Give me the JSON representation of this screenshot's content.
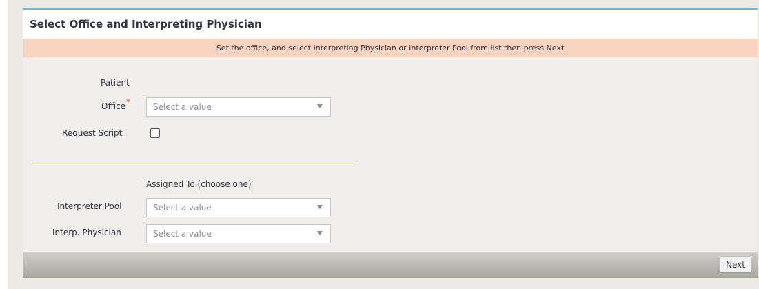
{
  "header": {
    "title": "Select Office and Interpreting Physician"
  },
  "banner": {
    "text": "Set the office, and select Interpreting Physician or Interpreter Pool from list then press Next"
  },
  "form": {
    "patient_label": "Patient",
    "office_label": "Office",
    "office_required_marker": "*",
    "office_select": "Select a value",
    "request_script_label": "Request Script",
    "request_script_checked": false,
    "assigned_to_label": "Assigned To (choose one)",
    "interpreter_pool_label": "Interpreter Pool",
    "interpreter_pool_select": "Select a value",
    "interp_physician_label": "Interp. Physician",
    "interp_physician_select": "Select a value"
  },
  "footer": {
    "next_label": "Next"
  },
  "colors": {
    "accent_border": "#5bc0de",
    "banner_bg": "#f8d3c0",
    "required": "#e0302a"
  }
}
